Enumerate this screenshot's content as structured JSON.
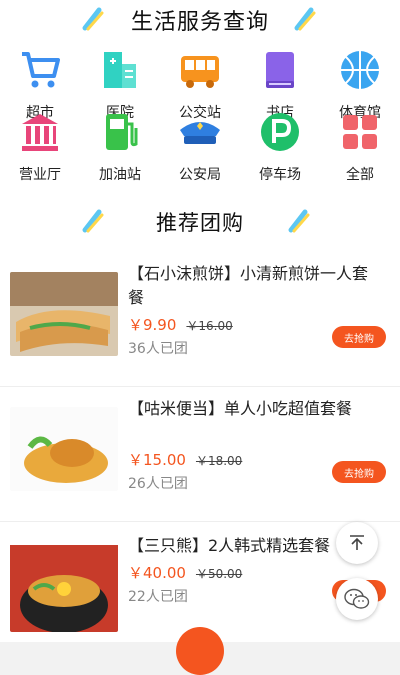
{
  "services": {
    "title": "生活服务查询",
    "items": [
      {
        "label": "超市",
        "icon": "shopping-cart-icon"
      },
      {
        "label": "医院",
        "icon": "hospital-icon"
      },
      {
        "label": "公交站",
        "icon": "bus-icon"
      },
      {
        "label": "书店",
        "icon": "book-icon"
      },
      {
        "label": "体育馆",
        "icon": "basketball-icon"
      },
      {
        "label": "营业厅",
        "icon": "bank-building-icon"
      },
      {
        "label": "加油站",
        "icon": "gas-station-icon"
      },
      {
        "label": "公安局",
        "icon": "police-cap-icon"
      },
      {
        "label": "停车场",
        "icon": "parking-icon"
      },
      {
        "label": "全部",
        "icon": "grid-all-icon"
      }
    ]
  },
  "recommend": {
    "title": "推荐团购",
    "deals": [
      {
        "name": "【石小沫煎饼】小清新煎饼一人套餐",
        "price": "￥9.90",
        "old_price": "￥16.00",
        "sold": "36人已团",
        "buy_label": "去抢购"
      },
      {
        "name": "【咕米便当】单人小吃超值套餐",
        "price": "￥15.00",
        "old_price": "￥18.00",
        "sold": "26人已团",
        "buy_label": "去抢购"
      },
      {
        "name": "【三只熊】2人韩式精选套餐",
        "price": "￥40.00",
        "old_price": "￥50.00",
        "sold": "22人已团",
        "buy_label": "去抢购"
      }
    ]
  },
  "floating": {
    "top_icon": "arrow-up-icon",
    "chat_icon": "wechat-icon"
  },
  "colors": {
    "accent": "#f4551f"
  }
}
